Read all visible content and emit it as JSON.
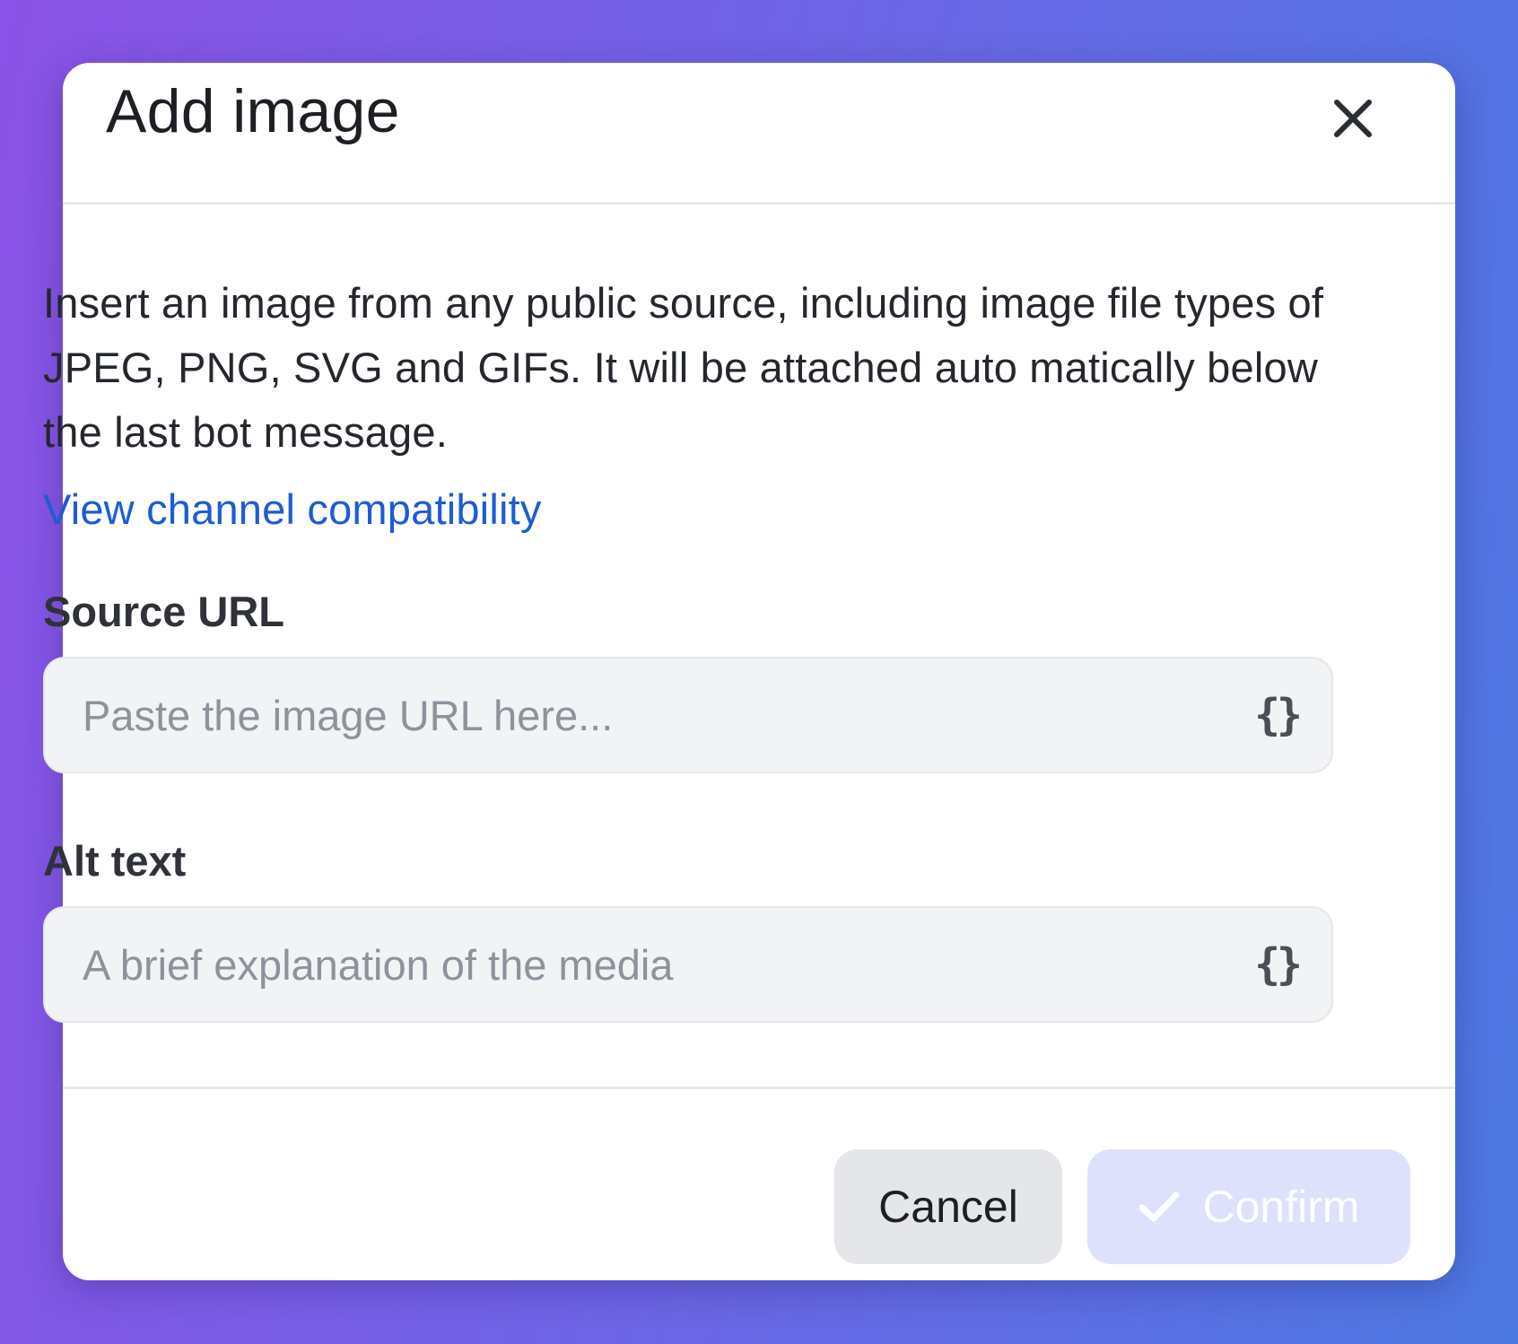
{
  "dialog": {
    "title": "Add image",
    "description": "Insert an image from any public source, including image file types of JPEG, PNG, SVG and GIFs. It will be attached auto matically below the last bot message.",
    "compat_link": "View channel compatibility"
  },
  "fields": {
    "source_url": {
      "label": "Source URL",
      "value": "",
      "placeholder": "Paste the image URL here...",
      "variable_button": "{}"
    },
    "alt_text": {
      "label": "Alt text",
      "value": "",
      "placeholder": "A brief explanation of the media",
      "variable_button": "{}"
    }
  },
  "footer": {
    "cancel_label": "Cancel",
    "confirm_label": "Confirm",
    "confirm_icon": "check-icon"
  },
  "icons": {
    "close": "close-icon",
    "variable": "braces-icon"
  },
  "colors": {
    "link": "#1e5bd6",
    "confirm_disabled_bg": "#dde1fb",
    "cancel_bg": "#e5e6e9",
    "input_bg": "#f2f3f5"
  }
}
